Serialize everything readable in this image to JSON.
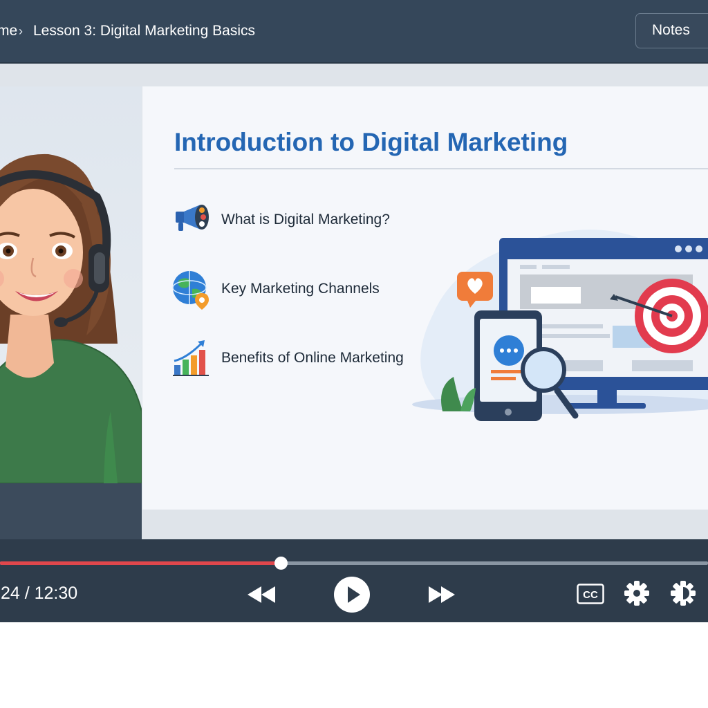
{
  "header": {
    "breadcrumb_home": "me",
    "breadcrumb_separator": "›",
    "breadcrumb_lesson": "Lesson 3: Digital Marketing Basics",
    "notes_label": "Notes"
  },
  "slide": {
    "title": "Introduction to Digital Marketing",
    "bullets": [
      {
        "icon": "megaphone-icon",
        "text": "What is Digital Marketing?"
      },
      {
        "icon": "globe-location-icon",
        "text": "Key Marketing Channels"
      },
      {
        "icon": "growth-chart-icon",
        "text": "Benefits of Online Marketing"
      }
    ]
  },
  "player": {
    "time_display": ":24 / 12:30",
    "progress_percent": 39.6,
    "icons": {
      "rewind": "rewind-icon",
      "play": "play-icon",
      "forward": "fast-forward-icon",
      "captions": "closed-captions-icon",
      "settings": "gear-icon",
      "quality": "quality-icon"
    }
  },
  "colors": {
    "topbar": "#35475a",
    "controls": "#2e3c4b",
    "accent_title": "#2466b3",
    "progress": "#e0474c"
  }
}
